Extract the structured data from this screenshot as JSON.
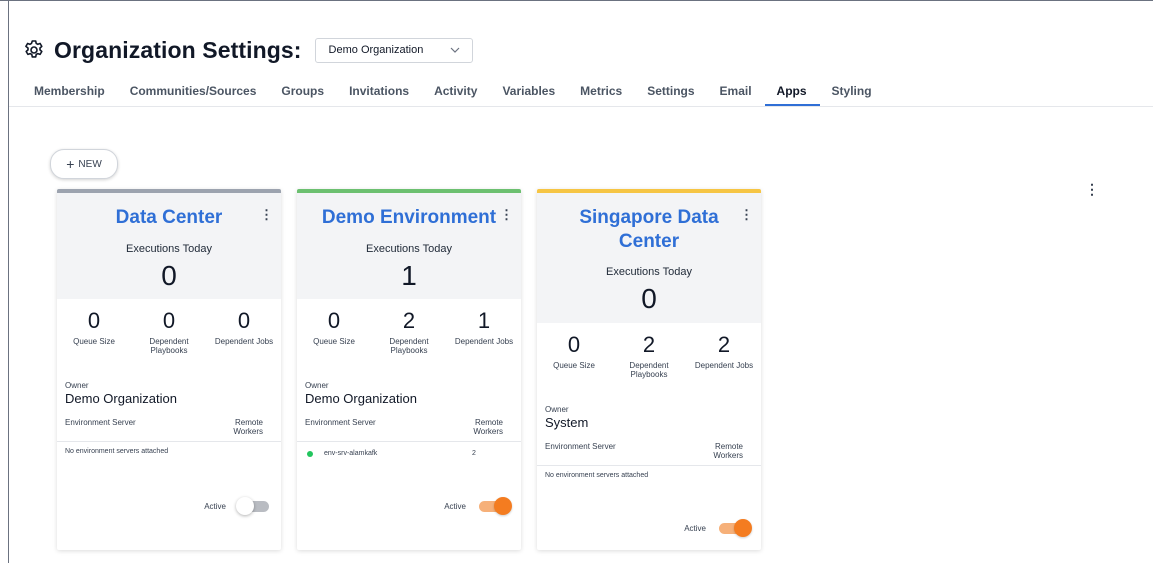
{
  "page": {
    "title": "Organization Settings:",
    "org_select": {
      "value": "Demo Organization"
    }
  },
  "tabs": [
    {
      "label": "Membership"
    },
    {
      "label": "Communities/Sources"
    },
    {
      "label": "Groups"
    },
    {
      "label": "Invitations"
    },
    {
      "label": "Activity"
    },
    {
      "label": "Variables"
    },
    {
      "label": "Metrics"
    },
    {
      "label": "Settings"
    },
    {
      "label": "Email"
    },
    {
      "label": "Apps",
      "active": true
    },
    {
      "label": "Styling"
    }
  ],
  "toolbar": {
    "new_label": "NEW",
    "new_icon": "plus-icon"
  },
  "cards": [
    {
      "name": "Data Center",
      "accent": "#9ca3af",
      "executions_label": "Executions Today",
      "executions_today": "0",
      "queue_size": "0",
      "queue_size_label": "Queue Size",
      "dependent_playbooks": "0",
      "dependent_playbooks_label": "Dependent Playbooks",
      "dependent_jobs": "0",
      "dependent_jobs_label": "Dependent Jobs",
      "owner_label": "Owner",
      "owner": "Demo Organization",
      "env_server_label": "Environment Server",
      "remote_workers_label": "Remote Workers",
      "empty_text": "No environment servers attached",
      "active_label": "Active",
      "active": false
    },
    {
      "name": "Demo Environment",
      "accent": "#6cc070",
      "executions_label": "Executions Today",
      "executions_today": "1",
      "queue_size": "0",
      "queue_size_label": "Queue Size",
      "dependent_playbooks": "2",
      "dependent_playbooks_label": "Dependent Playbooks",
      "dependent_jobs": "1",
      "dependent_jobs_label": "Dependent Jobs",
      "owner_label": "Owner",
      "owner": "Demo Organization",
      "env_server_label": "Environment Server",
      "remote_workers_label": "Remote Workers",
      "servers": [
        {
          "name": "env-srv-alamkafk",
          "workers": "2",
          "status_color": "#22c55e"
        }
      ],
      "active_label": "Active",
      "active": true
    },
    {
      "name": "Singapore Data Center",
      "accent": "#f6c544",
      "executions_label": "Executions Today",
      "executions_today": "0",
      "queue_size": "0",
      "queue_size_label": "Queue Size",
      "dependent_playbooks": "2",
      "dependent_playbooks_label": "Dependent Playbooks",
      "dependent_jobs": "2",
      "dependent_jobs_label": "Dependent Jobs",
      "owner_label": "Owner",
      "owner": "System",
      "env_server_label": "Environment Server",
      "remote_workers_label": "Remote Workers",
      "empty_text": "No environment servers attached",
      "active_label": "Active",
      "active": true
    }
  ],
  "colors": {
    "accent_blue": "#2f6fd6",
    "toggle_on": "#f47c20",
    "toggle_off": "#b9bcc2"
  }
}
